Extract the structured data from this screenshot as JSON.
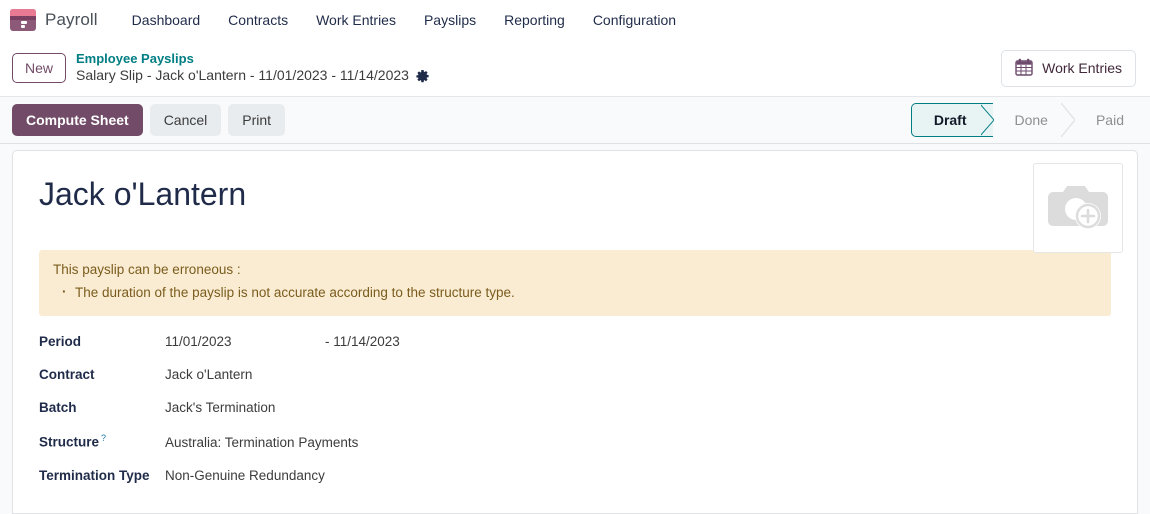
{
  "navbar": {
    "brand": "Payroll",
    "brand_icon": "payroll-app-icon",
    "items": [
      {
        "label": "Dashboard"
      },
      {
        "label": "Contracts"
      },
      {
        "label": "Work Entries"
      },
      {
        "label": "Payslips"
      },
      {
        "label": "Reporting"
      },
      {
        "label": "Configuration"
      }
    ]
  },
  "breadcrumb": {
    "new_button": "New",
    "parent": "Employee Payslips",
    "current": "Salary Slip - Jack o'Lantern - 11/01/2023 - 11/14/2023",
    "settings_icon": "gear-icon",
    "work_entries_button": "Work Entries",
    "work_entries_icon": "calendar-icon"
  },
  "toolbar": {
    "compute_sheet": "Compute Sheet",
    "cancel": "Cancel",
    "print": "Print",
    "statusbar": [
      {
        "label": "Draft",
        "active": true
      },
      {
        "label": "Done",
        "active": false
      },
      {
        "label": "Paid",
        "active": false
      }
    ]
  },
  "record": {
    "title": "Jack o'Lantern",
    "image_placeholder_icon": "camera-add-icon"
  },
  "alert": {
    "heading": "This payslip can be erroneous :",
    "items": [
      "The duration of the payslip is not accurate according to the structure type."
    ]
  },
  "form": {
    "period_label": "Period",
    "period_from": "11/01/2023",
    "period_to": "- 11/14/2023",
    "contract_label": "Contract",
    "contract_value": "Jack o'Lantern",
    "batch_label": "Batch",
    "batch_value": "Jack's Termination",
    "structure_label": "Structure",
    "structure_help": "?",
    "structure_value": "Australia: Termination Payments",
    "termination_type_label": "Termination Type",
    "termination_type_value": "Non-Genuine Redundancy"
  },
  "colors": {
    "brand_purple": "#714B67",
    "teal_link": "#017e84",
    "alert_bg": "#faecd2",
    "alert_text": "#7a5c1e",
    "status_active_border": "#017e84"
  }
}
